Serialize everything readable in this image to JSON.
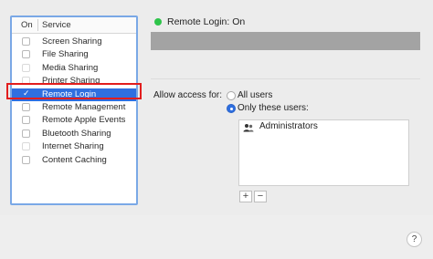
{
  "list": {
    "col_on": "On",
    "col_service": "Service",
    "items": [
      {
        "label": "Screen Sharing",
        "checked": false
      },
      {
        "label": "File Sharing",
        "checked": false
      },
      {
        "label": "Media Sharing",
        "checked": false
      },
      {
        "label": "Printer Sharing",
        "checked": false
      },
      {
        "label": "Remote Login",
        "checked": true,
        "selected": true
      },
      {
        "label": "Remote Management",
        "checked": false
      },
      {
        "label": "Remote Apple Events",
        "checked": false
      },
      {
        "label": "Bluetooth Sharing",
        "checked": false
      },
      {
        "label": "Internet Sharing",
        "checked": false
      },
      {
        "label": "Content Caching",
        "checked": false
      }
    ]
  },
  "status": {
    "text": "Remote Login: On",
    "color": "#2ec44a"
  },
  "access": {
    "label": "Allow access for:",
    "option_all": "All users",
    "option_only": "Only these users:",
    "selected": "only"
  },
  "users": [
    {
      "name": "Administrators",
      "icon": "group-icon"
    }
  ],
  "buttons": {
    "add": "+",
    "remove": "−",
    "help": "?"
  },
  "colors": {
    "selection": "#2f6fe0",
    "highlight": "#e21d1d",
    "list_border": "#7aa8e6"
  }
}
